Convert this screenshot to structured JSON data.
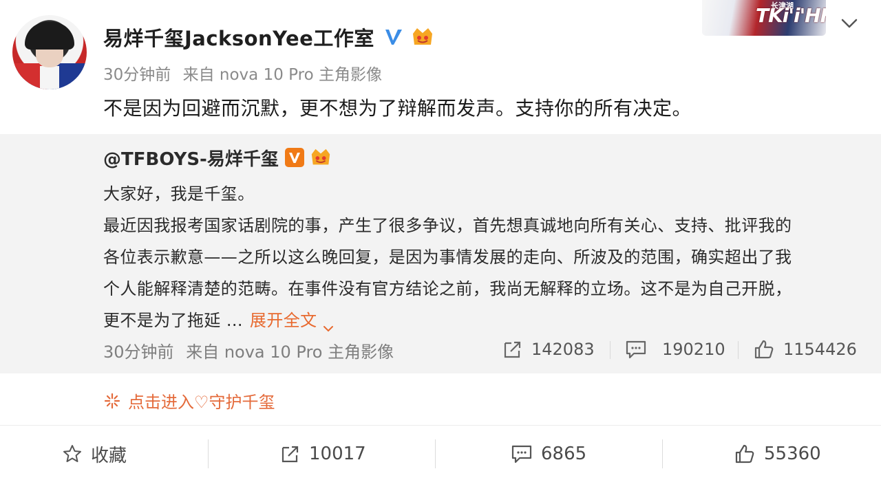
{
  "post": {
    "username": "易烊千玺JacksonYee工作室",
    "time": "30分钟前",
    "source": "来自 nova 10 Pro 主角影像",
    "text": "不是因为回避而沉默，更不想为了辩解而发声。支持你的所有决定。"
  },
  "banner": {
    "main_text": "TKi'i'HFS",
    "small_text": "长津湖"
  },
  "repost": {
    "handle": "@TFBOYS-易烊千玺",
    "lines": [
      "大家好，我是千玺。",
      "最近因我报考国家话剧院的事，产生了很多争议，首先想真诚地向所有关心、支持、批评我的",
      "各位表示歉意——之所以这么晚回复，是因为事情发展的走向、所波及的范围，确实超出了我",
      "个人能解释清楚的范畴。在事件没有官方结论之前，我尚无解释的立场。这不是为自己开脱，",
      "更不是为了拖延 ..."
    ],
    "expand_label": "展开全文",
    "time": "30分钟前",
    "source": "来自 nova 10 Pro 主角影像",
    "reposts": "142083",
    "comments": "190210",
    "likes": "1154426"
  },
  "link": {
    "label": "点击进入♡守护千玺"
  },
  "actions": {
    "favorite_label": "收藏",
    "repost_count": "10017",
    "comment_count": "6865",
    "like_count": "55360"
  },
  "colors": {
    "accent_orange": "#e8692e",
    "verified_blue": "#3b8de6",
    "verified_orange": "#f07a16",
    "repost_bg": "#f3f3f3"
  }
}
